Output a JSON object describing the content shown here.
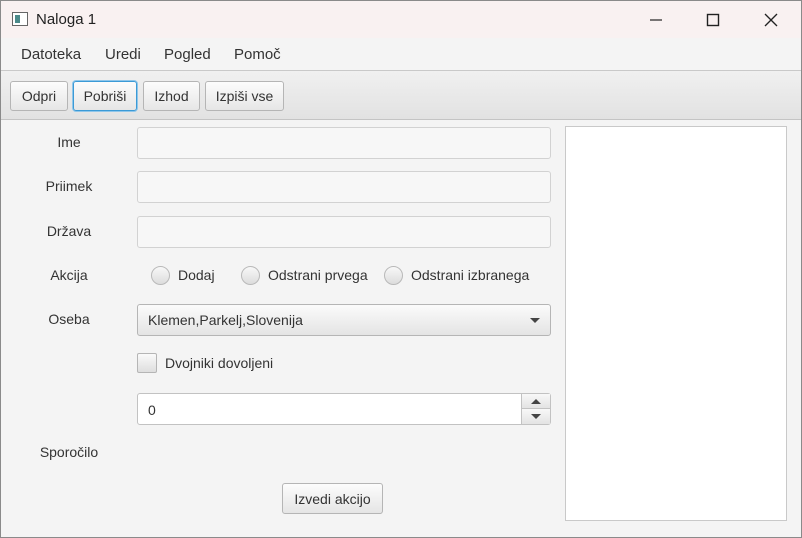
{
  "window": {
    "title": "Naloga 1"
  },
  "menu": {
    "items": [
      "Datoteka",
      "Uredi",
      "Pogled",
      "Pomoč"
    ]
  },
  "toolbar": {
    "buttons": [
      "Odpri",
      "Pobriši",
      "Izhod",
      "Izpiši vse"
    ]
  },
  "form": {
    "labels": {
      "name": "Ime",
      "surname": "Priimek",
      "country": "Država",
      "action": "Akcija",
      "person": "Oseba",
      "message": "Sporočilo"
    },
    "name_value": "",
    "surname_value": "",
    "country_value": "",
    "radio_options": [
      "Dodaj",
      "Odstrani prvega",
      "Odstrani izbranega"
    ],
    "person_selected": "Klemen,Parkelj,Slovenija",
    "duplicates_label": "Dvojniki dovoljeni",
    "spinner_value": "0",
    "action_button": "Izvedi akcijo"
  },
  "icons": [
    "app-icon",
    "minimize-icon",
    "maximize-icon",
    "close-icon",
    "chevron-down-icon",
    "spin-up-icon",
    "spin-down-icon"
  ]
}
